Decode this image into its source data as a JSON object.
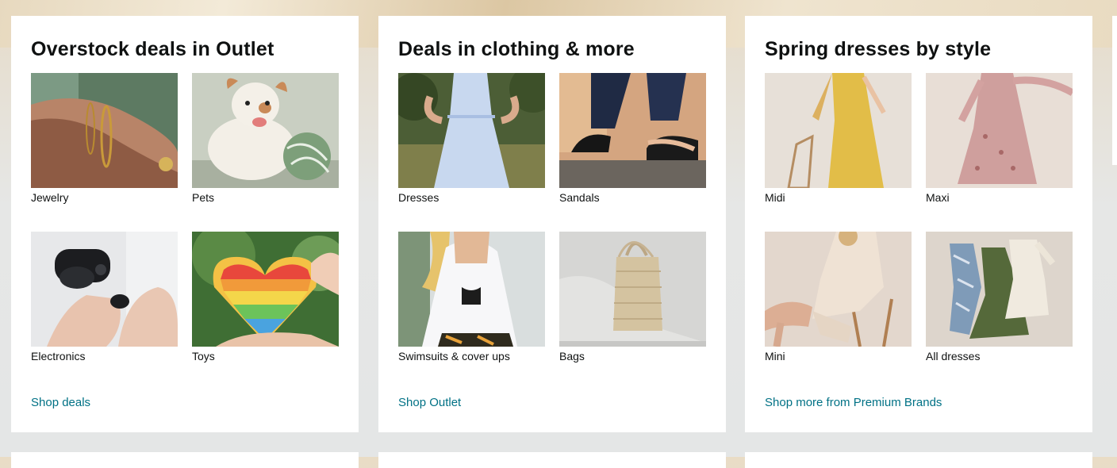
{
  "cards": [
    {
      "title": "Overstock deals in Outlet",
      "tiles": [
        {
          "label": "Jewelry"
        },
        {
          "label": "Pets"
        },
        {
          "label": "Electronics"
        },
        {
          "label": "Toys"
        }
      ],
      "link": "Shop deals"
    },
    {
      "title": "Deals in clothing & more",
      "tiles": [
        {
          "label": "Dresses"
        },
        {
          "label": "Sandals"
        },
        {
          "label": "Swimsuits & cover ups"
        },
        {
          "label": "Bags"
        }
      ],
      "link": "Shop Outlet"
    },
    {
      "title": "Spring dresses by style",
      "tiles": [
        {
          "label": "Midi"
        },
        {
          "label": "Maxi"
        },
        {
          "label": "Mini"
        },
        {
          "label": "All dresses"
        }
      ],
      "link": "Shop more from Premium Brands"
    }
  ],
  "colors": {
    "link": "#007185",
    "text": "#0f1111",
    "card_bg": "#ffffff"
  }
}
